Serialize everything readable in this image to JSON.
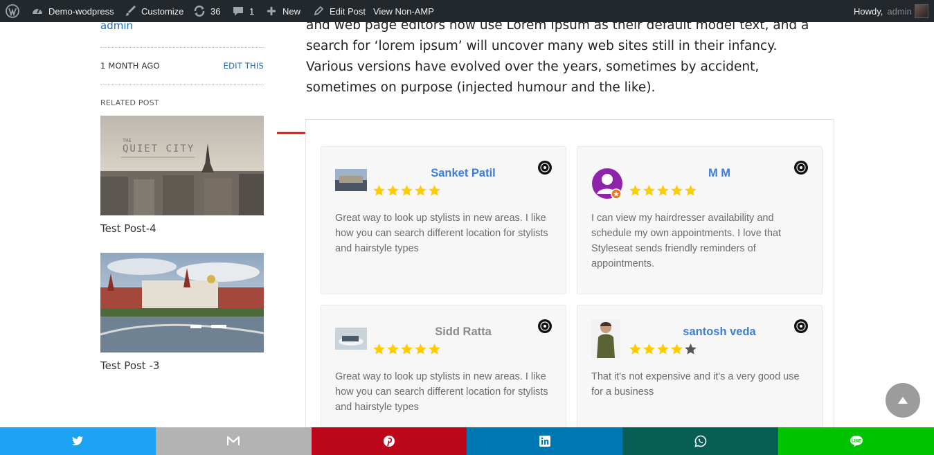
{
  "adminbar": {
    "site_name": "Demo-wodpress",
    "customize": "Customize",
    "updates_count": "36",
    "comments_count": "1",
    "new_label": "New",
    "edit_post": "Edit Post",
    "view_non_amp": "View Non-AMP",
    "howdy": "Howdy,",
    "user": "admin"
  },
  "sidebar": {
    "author": "admin",
    "date": "1 MONTH AGO",
    "edit": "EDIT THIS",
    "related_heading": "RELATED POST",
    "posts": [
      {
        "title": "Test Post-4",
        "image_text": "QUIET CITY",
        "image_small_text": "THE"
      },
      {
        "title": "Test Post -3"
      }
    ]
  },
  "article": {
    "text": "and web page editors now use Lorem Ipsum as their default model text, and a search for ‘lorem ipsum’ will uncover many web sites still in their infancy. Various versions have evolved over the years, sometimes by accident, sometimes on purpose (injected humour and the like)."
  },
  "reviews": [
    {
      "name": "Sanket Patil",
      "rating": 5,
      "name_color": "#3b7dd8",
      "text": "Great way to look up stylists in new areas. I like how you can search different location for stylists and hairstyle types"
    },
    {
      "name": "M M",
      "rating": 5,
      "name_color": "#3b7dd8",
      "text": "I can view my hairdresser availability and schedule my own appointments. I love that Styleseat sends friendly reminders of appointments."
    },
    {
      "name": "Sidd Ratta",
      "rating": 5,
      "name_color": "#8a8a8a",
      "text": "Great way to look up stylists in new areas. I like how you can search different location for stylists and hairstyle types"
    },
    {
      "name": "santosh veda",
      "rating": 4,
      "name_color": "#3b7dd8",
      "text": "That it's not expensive and it's a very good use for a business"
    }
  ],
  "colors": {
    "twitter": "#1da1f2",
    "email": "#b3b3b3",
    "pinterest": "#bd081c",
    "linkedin": "#0077b5",
    "whatsapp": "#075e54",
    "line": "#00c300",
    "star": "#ffcc00",
    "star_empty": "#555555"
  },
  "share": [
    "twitter-icon",
    "email-icon",
    "pinterest-icon",
    "linkedin-icon",
    "whatsapp-icon",
    "line-icon"
  ]
}
